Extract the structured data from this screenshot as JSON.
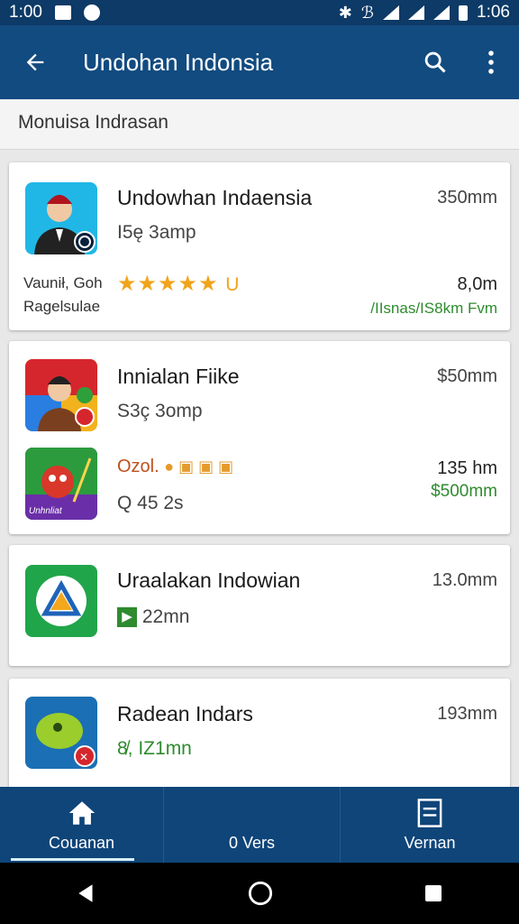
{
  "status_bar": {
    "time": "1:00",
    "clock": "1:06"
  },
  "app_bar": {
    "title": "Undohan Indonsia",
    "back_icon": "arrow-left-icon",
    "search_icon": "search-icon",
    "more_icon": "more-vertical-icon"
  },
  "subheader": {
    "text": "Monuisa Indrasan"
  },
  "items": [
    {
      "name": "Undowhan Indaensia",
      "meta": "I5ę 3amp",
      "size": "350mm",
      "footer_left_1": "Vaunił, Goh",
      "footer_left_2": "Ragelsulae",
      "rating_suffix": "U",
      "footer_right_1": "8,0m",
      "footer_right_2": "/IIsnas/IS8km Fvm",
      "icon": "person-avatar-icon",
      "colors": {
        "bg": "#20b7e6"
      }
    },
    {
      "name": "Innialan Fiike",
      "meta": "S3ç 3omp",
      "size": "$50mm",
      "icon": "person-avatar-icon",
      "sub_text": "Ozol.",
      "sub_meta": "Q 45 2s",
      "sub_right_1": "135 hm",
      "sub_right_2": "$500mm",
      "sub_icon": "monster-game-icon",
      "sub_icon_label": "Unhnliat"
    },
    {
      "name": "Uraalakan Indowian",
      "meta": "22mn",
      "size": "13.0mm",
      "icon": "triangle-logo-icon"
    },
    {
      "name": "Radean Indars",
      "meta": "8̸, IZ1mn",
      "size": "193mm",
      "icon": "green-creature-icon"
    }
  ],
  "bottom_nav": [
    {
      "label": "Couanan",
      "icon": "home-icon",
      "active": true
    },
    {
      "label": "0 Vers",
      "icon": "",
      "active": false
    },
    {
      "label": "Vernan",
      "icon": "list-icon",
      "active": false
    }
  ],
  "colors": {
    "primary": "#124b80",
    "accent_green": "#2e8b2e",
    "star": "#f0a41c"
  }
}
